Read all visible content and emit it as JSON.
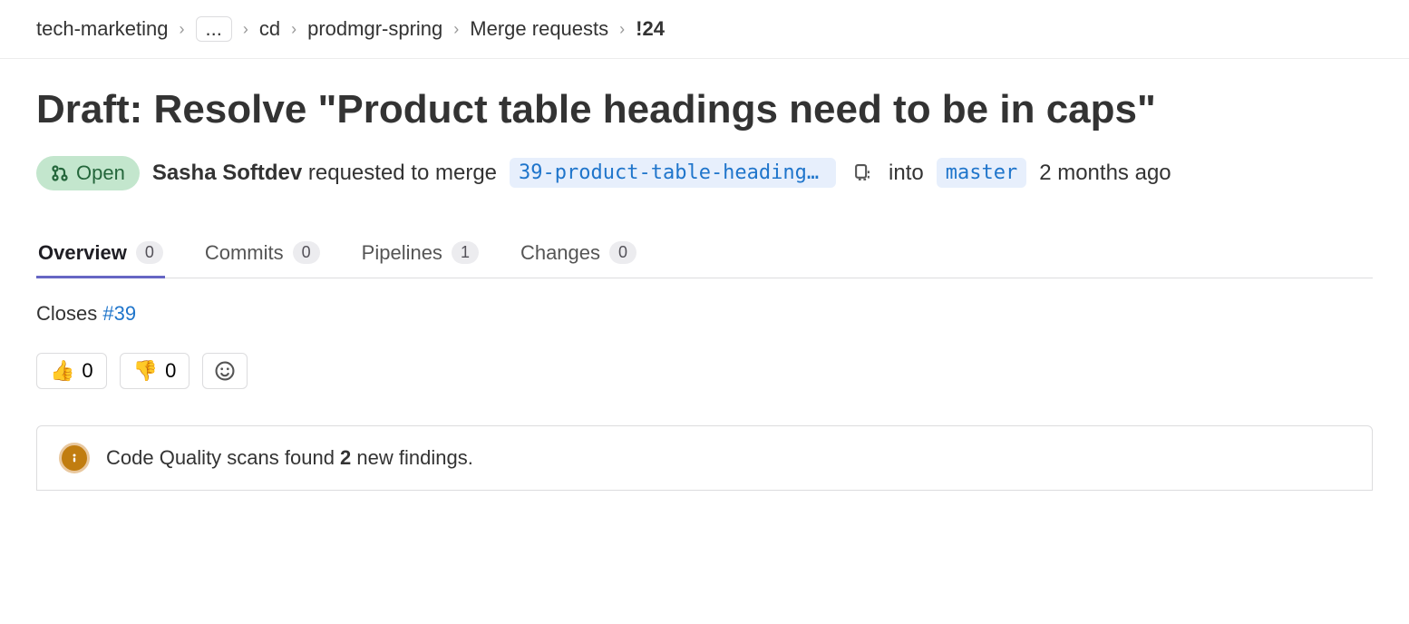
{
  "breadcrumbs": {
    "root": "tech-marketing",
    "ellipsis": "...",
    "cd": "cd",
    "project": "prodmgr-spring",
    "section": "Merge requests",
    "mr_id": "!24"
  },
  "title": "Draft: Resolve \"Product table headings need to be in caps\"",
  "status": {
    "label": "Open"
  },
  "request": {
    "author": "Sasha Softdev",
    "verb": " requested to merge ",
    "source_branch": "39-product-table-headings-…",
    "into": "into",
    "target_branch": "master",
    "timestamp": "2 months ago"
  },
  "tabs": [
    {
      "label": "Overview",
      "count": "0"
    },
    {
      "label": "Commits",
      "count": "0"
    },
    {
      "label": "Pipelines",
      "count": "1"
    },
    {
      "label": "Changes",
      "count": "0"
    }
  ],
  "description": {
    "closes": "Closes ",
    "issue": "#39"
  },
  "reactions": {
    "thumbs_up": "0",
    "thumbs_down": "0"
  },
  "code_quality": {
    "pre": "Code Quality scans found ",
    "count": "2",
    "post": " new findings."
  }
}
